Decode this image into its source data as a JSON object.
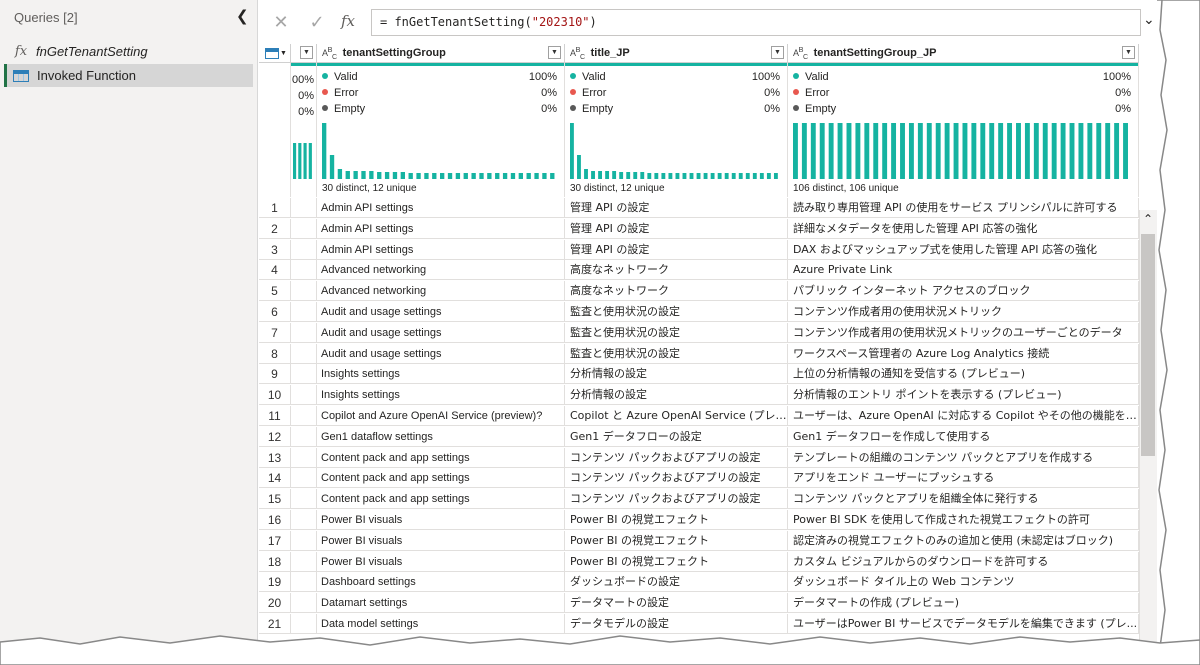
{
  "queries_pane": {
    "title": "Queries [2]",
    "items": [
      {
        "label": "fnGetTenantSetting",
        "icon": "function-icon"
      },
      {
        "label": "Invoked Function",
        "icon": "table-icon"
      }
    ]
  },
  "formula_bar": {
    "cancel_icon": "✕",
    "commit_icon": "✓",
    "fx_label": "fx",
    "prefix": "= fnGetTenantSetting(",
    "arg": "\"202310\"",
    "suffix": ")"
  },
  "columns": [
    {
      "type": "ABC",
      "name": "tenantSettingGroup"
    },
    {
      "type": "ABC",
      "name": "title_JP"
    },
    {
      "type": "ABC",
      "name": "tenantSettingGroup_JP"
    }
  ],
  "partial_column": {
    "valid": "00%",
    "error": "0%",
    "empty": "0%"
  },
  "quality": [
    {
      "valid": "Valid",
      "valid_pct": "100%",
      "error": "Error",
      "error_pct": "0%",
      "empty": "Empty",
      "empty_pct": "0%",
      "distinct": "30 distinct, 12 unique"
    },
    {
      "valid": "Valid",
      "valid_pct": "100%",
      "error": "Error",
      "error_pct": "0%",
      "empty": "Empty",
      "empty_pct": "0%",
      "distinct": "30 distinct, 12 unique"
    },
    {
      "valid": "Valid",
      "valid_pct": "100%",
      "error": "Error",
      "error_pct": "0%",
      "empty": "Empty",
      "empty_pct": "0%",
      "distinct": "106 distinct, 106 unique"
    }
  ],
  "colors": {
    "valid": "#15b3a1",
    "error": "#e8584f",
    "empty": "#595959",
    "accent": "#217346"
  },
  "rows": [
    {
      "n": "1",
      "a": "Admin API settings",
      "b": "管理 API の設定",
      "c": "読み取り専用管理 API の使用をサービス プリンシパルに許可する"
    },
    {
      "n": "2",
      "a": "Admin API settings",
      "b": "管理 API の設定",
      "c": "詳細なメタデータを使用した管理 API 応答の強化"
    },
    {
      "n": "3",
      "a": "Admin API settings",
      "b": "管理 API の設定",
      "c": "DAX およびマッシュアップ式を使用した管理 API 応答の強化"
    },
    {
      "n": "4",
      "a": "Advanced networking",
      "b": "高度なネットワーク",
      "c": "Azure Private Link"
    },
    {
      "n": "5",
      "a": "Advanced networking",
      "b": "高度なネットワーク",
      "c": "パブリック インターネット アクセスのブロック"
    },
    {
      "n": "6",
      "a": "Audit and usage settings",
      "b": "監査と使用状況の設定",
      "c": "コンテンツ作成者用の使用状況メトリック"
    },
    {
      "n": "7",
      "a": "Audit and usage settings",
      "b": "監査と使用状況の設定",
      "c": "コンテンツ作成者用の使用状況メトリックのユーザーごとのデータ"
    },
    {
      "n": "8",
      "a": "Audit and usage settings",
      "b": "監査と使用状況の設定",
      "c": "ワークスペース管理者の Azure Log Analytics 接続"
    },
    {
      "n": "9",
      "a": "Insights settings",
      "b": "分析情報の設定",
      "c": "上位の分析情報の通知を受信する (プレビュー)"
    },
    {
      "n": "10",
      "a": "Insights settings",
      "b": "分析情報の設定",
      "c": "分析情報のエントリ ポイントを表示する (プレビュー)"
    },
    {
      "n": "11",
      "a": "Copilot and Azure OpenAI Service (preview)?",
      "b": "Copilot と Azure OpenAI Service (プレビュー)",
      "c": "ユーザーは、Azure OpenAI に対応する Copilot やその他の機能を使..."
    },
    {
      "n": "12",
      "a": "Gen1 dataflow settings",
      "b": "Gen1 データフローの設定",
      "c": "Gen1 データフローを作成して使用する"
    },
    {
      "n": "13",
      "a": "Content pack and app settings",
      "b": "コンテンツ パックおよびアプリの設定",
      "c": "テンプレートの組織のコンテンツ パックとアプリを作成する"
    },
    {
      "n": "14",
      "a": "Content pack and app settings",
      "b": "コンテンツ パックおよびアプリの設定",
      "c": "アプリをエンド ユーザーにプッシュする"
    },
    {
      "n": "15",
      "a": "Content pack and app settings",
      "b": "コンテンツ パックおよびアプリの設定",
      "c": "コンテンツ パックとアプリを組織全体に発行する"
    },
    {
      "n": "16",
      "a": "Power BI visuals",
      "b": "Power BI の視覚エフェクト",
      "c": "Power BI SDK を使用して作成された視覚エフェクトの許可"
    },
    {
      "n": "17",
      "a": "Power BI visuals",
      "b": "Power BI の視覚エフェクト",
      "c": "認定済みの視覚エフェクトのみの追加と使用 (未認定はブロック)"
    },
    {
      "n": "18",
      "a": "Power BI visuals",
      "b": "Power BI の視覚エフェクト",
      "c": "カスタム ビジュアルからのダウンロードを許可する"
    },
    {
      "n": "19",
      "a": "Dashboard settings",
      "b": "ダッシュボードの設定",
      "c": "ダッシュボード タイル上の Web コンテンツ"
    },
    {
      "n": "20",
      "a": "Datamart settings",
      "b": "データマートの設定",
      "c": "データマートの作成 (プレビュー)"
    },
    {
      "n": "21",
      "a": "Data model settings",
      "b": "データモデルの設定",
      "c": "ユーザーはPower BI サービスでデータモデルを編集できます (プレ..."
    }
  ]
}
